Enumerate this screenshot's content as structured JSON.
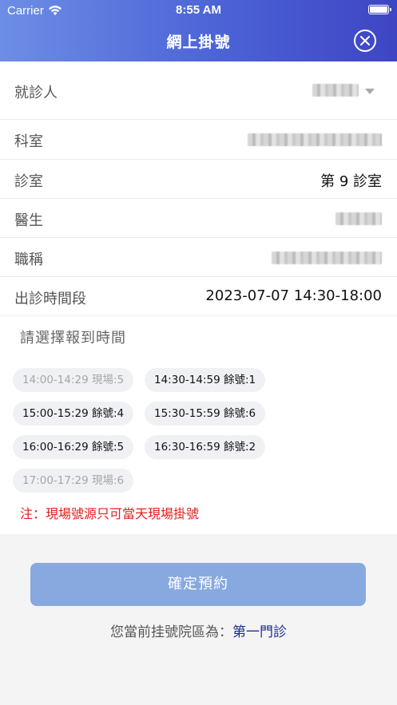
{
  "status_bar": {
    "carrier": "Carrier",
    "time": "8:55 AM"
  },
  "header": {
    "title": "網上掛號"
  },
  "form": {
    "patient": {
      "label": "就診人"
    },
    "department": {
      "label": "科室"
    },
    "room": {
      "label": "診室",
      "value": "第 9 診室"
    },
    "doctor": {
      "label": "醫生"
    },
    "job_title": {
      "label": "職稱"
    },
    "session": {
      "label": "出診時間段",
      "value": "2023-07-07 14:30-18:00"
    }
  },
  "slots_section": {
    "title": "請選擇報到時間"
  },
  "slots": [
    {
      "label": "14:00-14:29 現場:5",
      "enabled": false
    },
    {
      "label": "14:30-14:59 餘號:1",
      "enabled": true
    },
    {
      "label": "15:00-15:29 餘號:4",
      "enabled": true
    },
    {
      "label": "15:30-15:59 餘號:6",
      "enabled": true
    },
    {
      "label": "16:00-16:29 餘號:5",
      "enabled": true
    },
    {
      "label": "16:30-16:59 餘號:2",
      "enabled": true
    },
    {
      "label": "17:00-17:29 現場:6",
      "enabled": false
    }
  ],
  "note": "注：現場號源只可當天現場掛號",
  "confirm_button": {
    "label": "確定預約"
  },
  "campus": {
    "prefix": "您當前挂號院區為：",
    "name": "第一門診"
  },
  "colors": {
    "header_start": "#6d8ee6",
    "header_end": "#3e45c4",
    "button": "#87a9df",
    "note": "#e0201b",
    "campus_name": "#1f2f8f"
  }
}
